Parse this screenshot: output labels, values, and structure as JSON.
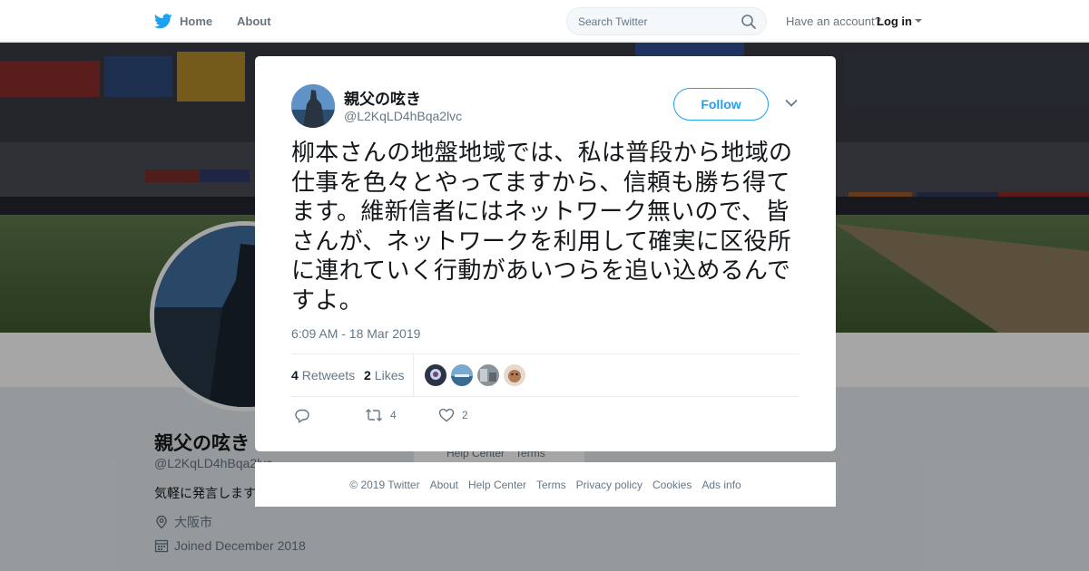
{
  "nav": {
    "home_label": "Home",
    "about_label": "About",
    "search_placeholder": "Search Twitter",
    "account_prompt": "Have an account?",
    "login_label": "Log in",
    "brand_color": "#1da1f2"
  },
  "profile": {
    "name": "親父の呟き",
    "handle": "@L2KqLD4hBqa2lvc",
    "bio": "気軽に発言します",
    "location": "大阪市",
    "joined": "Joined December 2018"
  },
  "background_links": [
    "Help Center",
    "Terms"
  ],
  "tweet": {
    "author_name": "親父の呟き",
    "author_handle": "@L2KqLD4hBqa2lvc",
    "follow_label": "Follow",
    "text": "柳本さんの地盤地域では、私は普段から地域の仕事を色々とやってますから、信頼も勝ち得てます。維新信者にはネットワーク無いので、皆さんが、ネットワークを利用して確実に区役所に連れていく行動があいつらを追い込めるんですよ。",
    "timestamp": "6:09 AM - 18 Mar 2019",
    "retweets_count": "4",
    "retweets_label": "Retweets",
    "likes_count": "2",
    "likes_label": "Likes",
    "action_retweet_count": "4",
    "action_like_count": "2"
  },
  "footer": {
    "links": [
      "© 2019 Twitter",
      "About",
      "Help Center",
      "Terms",
      "Privacy policy",
      "Cookies",
      "Ads info"
    ]
  },
  "icons": {
    "brand": "twitter-bird-icon",
    "search": "search-icon",
    "close": "close-icon",
    "chevron": "chevron-down-icon",
    "reply": "reply-icon",
    "retweet": "retweet-icon",
    "like": "heart-icon",
    "location": "location-pin-icon",
    "calendar": "calendar-icon"
  }
}
